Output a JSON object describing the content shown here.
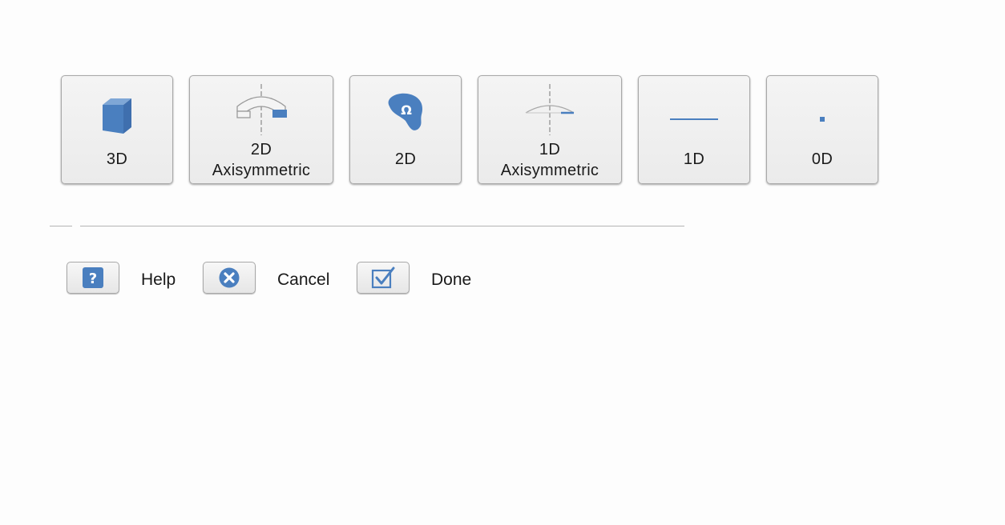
{
  "dimension_buttons": [
    {
      "label_line1": "3D",
      "label_line2": "",
      "icon": "cube-icon"
    },
    {
      "label_line1": "2D",
      "label_line2": "Axisymmetric",
      "icon": "half-ring-axis-icon"
    },
    {
      "label_line1": "2D",
      "label_line2": "",
      "icon": "omega-domain-icon"
    },
    {
      "label_line1": "1D",
      "label_line2": "Axisymmetric",
      "icon": "arc-axis-icon"
    },
    {
      "label_line1": "1D",
      "label_line2": "",
      "icon": "line-icon"
    },
    {
      "label_line1": "0D",
      "label_line2": "",
      "icon": "point-icon"
    }
  ],
  "actions": {
    "help": {
      "label": "Help",
      "icon": "question-icon"
    },
    "cancel": {
      "label": "Cancel",
      "icon": "close-icon"
    },
    "done": {
      "label": "Done",
      "icon": "checkbox-icon"
    }
  },
  "colors": {
    "accent": "#4a7fbf",
    "outline": "#9a9a9a"
  },
  "glyphs": {
    "omega": "Ω",
    "question": "?"
  }
}
